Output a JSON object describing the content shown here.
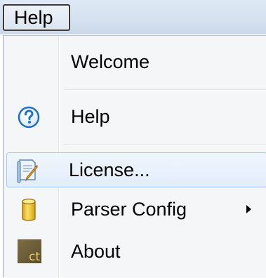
{
  "menubar": {
    "help_label": "Help"
  },
  "menu": {
    "items": [
      {
        "label": "Welcome",
        "icon": "none"
      },
      {
        "label": "Help",
        "icon": "question-circle-icon"
      },
      {
        "label": "License...",
        "icon": "license-document-icon",
        "highlighted": true
      },
      {
        "label": "Parser Config",
        "icon": "database-cylinder-icon",
        "has_submenu": true
      },
      {
        "label": "About",
        "icon": "app-logo-icon",
        "icon_text": "ct"
      }
    ]
  },
  "colors": {
    "highlight_border": "#a8c8ef",
    "highlight_fill": "#e2edfb",
    "menu_background": "#f5f6f7",
    "help_icon": "#1f6fc8",
    "cylinder": "#f2c318"
  }
}
